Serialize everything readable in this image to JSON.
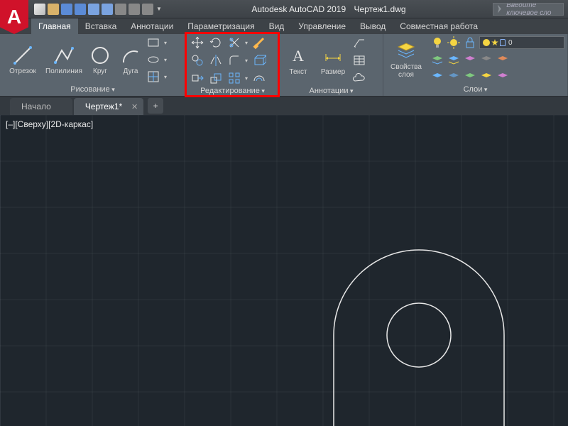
{
  "app": {
    "name": "Autodesk AutoCAD 2019",
    "filename": "Чертеж1.dwg",
    "logo": "A"
  },
  "search": {
    "placeholder": "Введите ключевое сло"
  },
  "ribbon_tabs": [
    "Главная",
    "Вставка",
    "Аннотации",
    "Параметризация",
    "Вид",
    "Управление",
    "Вывод",
    "Совместная работа"
  ],
  "panels": {
    "draw": {
      "label": "Рисование",
      "tools": {
        "line": "Отрезок",
        "polyline": "Полилиния",
        "circle": "Круг",
        "arc": "Дуга"
      }
    },
    "edit": {
      "label": "Редактирование"
    },
    "anno": {
      "label": "Аннотации",
      "text": "Текст",
      "dim": "Размер"
    },
    "layers": {
      "label": "Слои",
      "props": "Свойства\nслоя",
      "current": "0"
    }
  },
  "doc_tabs": {
    "start": "Начало",
    "active": "Чертеж1*"
  },
  "viewport": {
    "label": "[–][Сверху][2D-каркас]"
  }
}
